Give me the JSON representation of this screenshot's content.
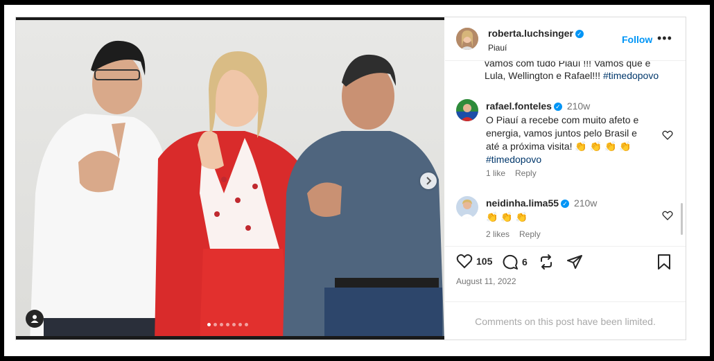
{
  "post": {
    "author": "roberta.luchsinger",
    "location": "Piauí",
    "follow_label": "Follow",
    "more_label": "•••",
    "caption": "vamos com tudo Piauí !!! Vamos que é Lula, Wellington e Rafael!!! ",
    "caption_tag": "#timedopovo"
  },
  "comments": [
    {
      "user": "rafael.fonteles",
      "age": "210w",
      "text": "O Piauí a recebe com muito afeto e energia, vamos juntos pelo Brasil e até a próxima visita! 👏 👏 👏 👏 ",
      "tag": "#timedopovo",
      "likes": "1 like",
      "reply": "Reply"
    },
    {
      "user": "neidinha.lima55",
      "age": "210w",
      "text": "👏 👏 👏",
      "likes": "2 likes",
      "reply": "Reply"
    }
  ],
  "actions": {
    "likes_count": "105",
    "comments_count": "6",
    "date": "August 11, 2022",
    "limited_notice": "Comments on this post have been limited."
  },
  "carousel": {
    "total_slides": 7,
    "active_index": 0
  }
}
